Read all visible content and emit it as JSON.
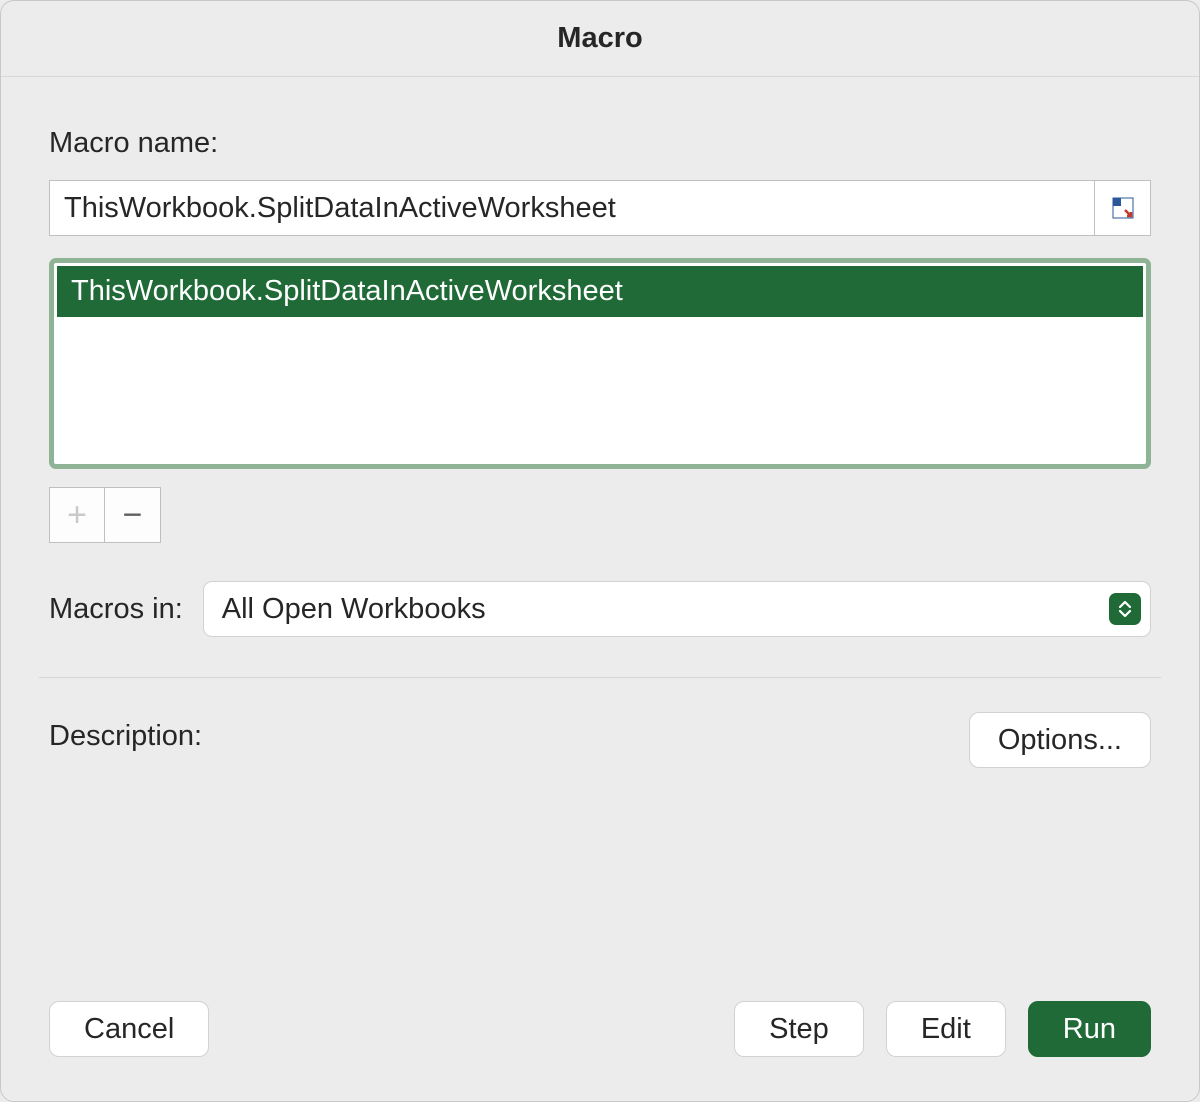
{
  "title": "Macro",
  "macro_name_label": "Macro name:",
  "macro_name_value": "ThisWorkbook.SplitDataInActiveWorksheet",
  "macro_list": {
    "items": [
      "ThisWorkbook.SplitDataInActiveWorksheet"
    ]
  },
  "add_label": "+",
  "remove_label": "−",
  "macros_in_label": "Macros in:",
  "macros_in_value": "All Open Workbooks",
  "description_label": "Description:",
  "options_label": "Options...",
  "footer": {
    "cancel": "Cancel",
    "step": "Step",
    "edit": "Edit",
    "run": "Run"
  }
}
